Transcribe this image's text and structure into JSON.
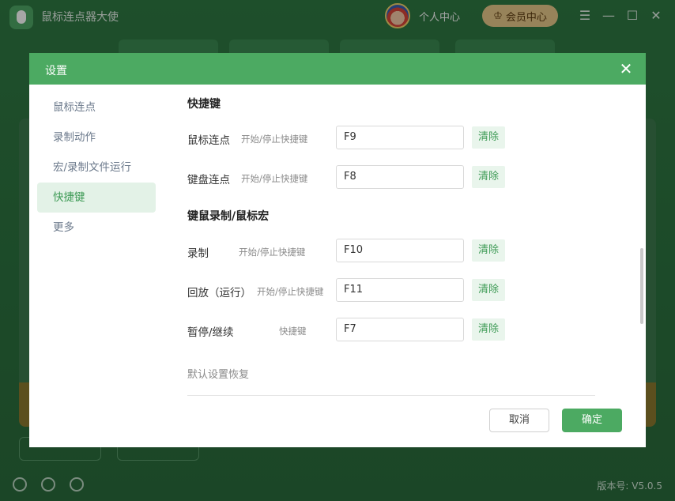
{
  "app": {
    "title": "鼠标连点器大使",
    "user_center": "个人中心",
    "vip_label": "会员中心",
    "version": "版本号: V5.0.5"
  },
  "dialog": {
    "title": "设置",
    "nav": [
      {
        "label": "鼠标连点"
      },
      {
        "label": "录制动作"
      },
      {
        "label": "宏/录制文件运行"
      },
      {
        "label": "快捷键",
        "active": true
      },
      {
        "label": "更多"
      }
    ],
    "sections": {
      "hotkeys_title": "快捷键",
      "macro_title": "键鼠录制/鼠标宏"
    },
    "rows": [
      {
        "label": "鼠标连点",
        "hint": "开始/停止快捷键",
        "value": "F9",
        "clear": "清除"
      },
      {
        "label": "键盘连点",
        "hint": "开始/停止快捷键",
        "value": "F8",
        "clear": "清除"
      },
      {
        "label": "录制",
        "hint": "开始/停止快捷键",
        "value": "F10",
        "clear": "清除"
      },
      {
        "label": "回放（运行）",
        "hint": "开始/停止快捷键",
        "value": "F11",
        "clear": "清除"
      },
      {
        "label": "暂停/继续",
        "hint": "快捷键",
        "value": "F7",
        "clear": "清除"
      }
    ],
    "restore_defaults": "默认设置恢复",
    "cancel": "取消",
    "ok": "确定"
  },
  "colors": {
    "accent": "#4caa62",
    "clear_bg": "#e9f5ec",
    "nav_active_bg": "#e3f2e7"
  }
}
